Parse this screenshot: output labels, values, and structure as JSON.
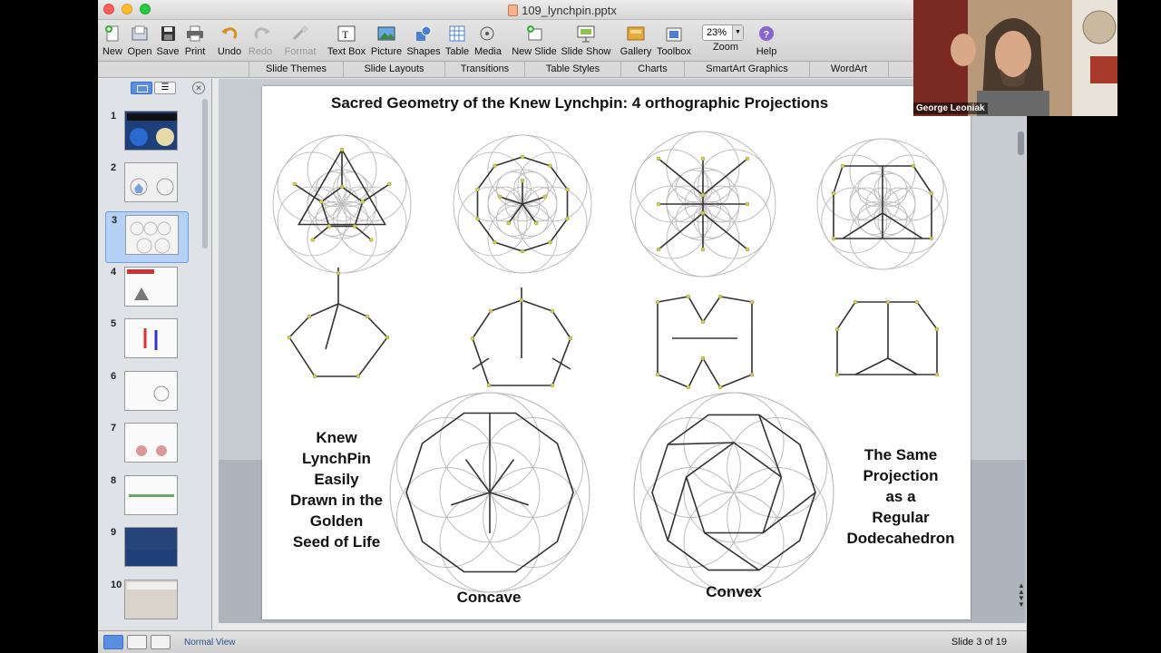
{
  "window": {
    "title": "109_lynchpin.pptx"
  },
  "toolbar": {
    "buttons": [
      {
        "label": "New",
        "icon": "new-doc-icon"
      },
      {
        "label": "Open",
        "icon": "open-icon"
      },
      {
        "label": "Save",
        "icon": "save-icon"
      },
      {
        "label": "Print",
        "icon": "print-icon"
      },
      {
        "label": "Undo",
        "icon": "undo-icon"
      },
      {
        "label": "Redo",
        "icon": "redo-icon"
      },
      {
        "label": "Format",
        "icon": "format-brush-icon"
      },
      {
        "label": "Text Box",
        "icon": "text-box-icon"
      },
      {
        "label": "Picture",
        "icon": "picture-icon"
      },
      {
        "label": "Shapes",
        "icon": "shapes-icon"
      },
      {
        "label": "Table",
        "icon": "table-icon"
      },
      {
        "label": "Media",
        "icon": "media-icon"
      },
      {
        "label": "New Slide",
        "icon": "new-slide-icon"
      },
      {
        "label": "Slide Show",
        "icon": "slide-show-icon"
      },
      {
        "label": "Gallery",
        "icon": "gallery-icon"
      },
      {
        "label": "Toolbox",
        "icon": "toolbox-icon"
      },
      {
        "label": "Zoom",
        "icon": "zoom-icon"
      },
      {
        "label": "Help",
        "icon": "help-icon"
      }
    ],
    "zoom_value": "23%"
  },
  "ribbon": {
    "tabs": [
      "Slide Themes",
      "Slide Layouts",
      "Transitions",
      "Table Styles",
      "Charts",
      "SmartArt Graphics",
      "WordArt"
    ]
  },
  "sidebar": {
    "slides": [
      {
        "number": "1"
      },
      {
        "number": "2"
      },
      {
        "number": "3"
      },
      {
        "number": "4"
      },
      {
        "number": "5"
      },
      {
        "number": "6"
      },
      {
        "number": "7"
      },
      {
        "number": "8"
      },
      {
        "number": "9"
      },
      {
        "number": "10"
      }
    ],
    "selected_slide": "3"
  },
  "slide": {
    "title": "Sacred Geometry of the Knew Lynchpin:  4 orthographic Projections",
    "left_text": [
      "Knew",
      "LynchPin",
      "Easily",
      "Drawn in the",
      "Golden",
      "Seed of Life"
    ],
    "right_text": [
      "The Same",
      "Projection",
      "as a",
      "Regular",
      "Dodecahedron"
    ],
    "label_concave": "Concave",
    "label_convex": "Convex"
  },
  "status": {
    "view_label": "Normal View",
    "slide_indicator": "Slide 3 of 19"
  },
  "webcam": {
    "name": "George Leoniak"
  },
  "colors": {
    "selection": "#b5d1f5",
    "accent": "#5a8ee0",
    "vertex": "#d8d820",
    "edge": "#333333"
  }
}
